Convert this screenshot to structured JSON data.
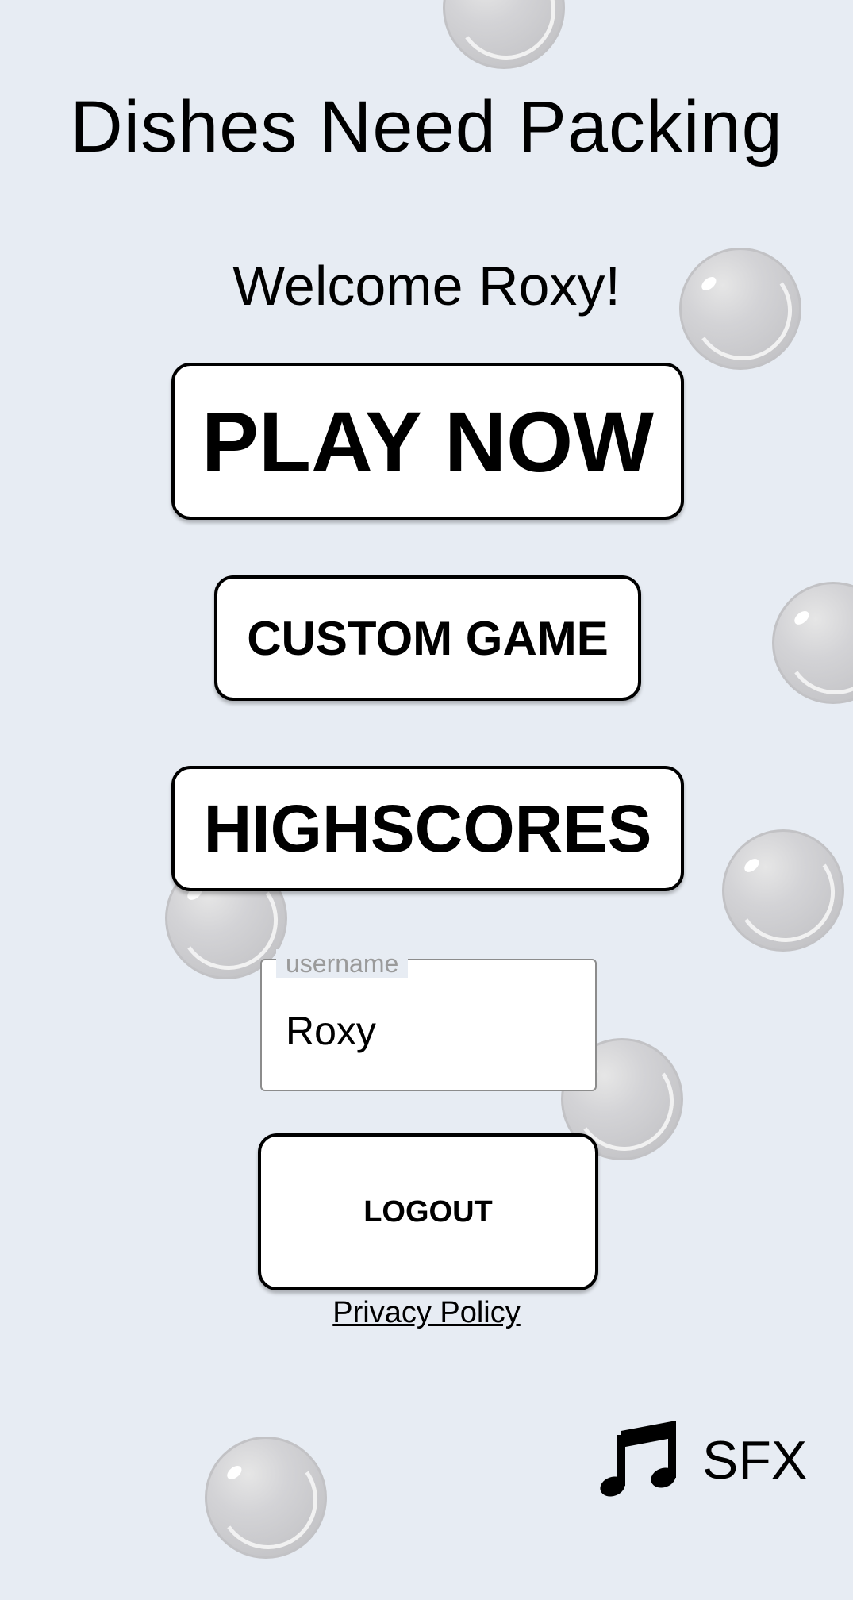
{
  "title": "Dishes Need Packing",
  "welcome": "Welcome Roxy!",
  "buttons": {
    "play_now": "PLAY NOW",
    "custom_game": "CUSTOM GAME",
    "highscores": "HIGHSCORES",
    "logout": "LOGOUT"
  },
  "username_field": {
    "label": "username",
    "value": "Roxy"
  },
  "privacy_link": "Privacy Policy",
  "audio": {
    "music_icon": "music-note-icon",
    "sfx_label": "SFX"
  },
  "colors": {
    "background": "#e7ecf3",
    "button_fill": "#ffffff",
    "button_border": "#000000",
    "bubble": "#c9c9cc"
  }
}
